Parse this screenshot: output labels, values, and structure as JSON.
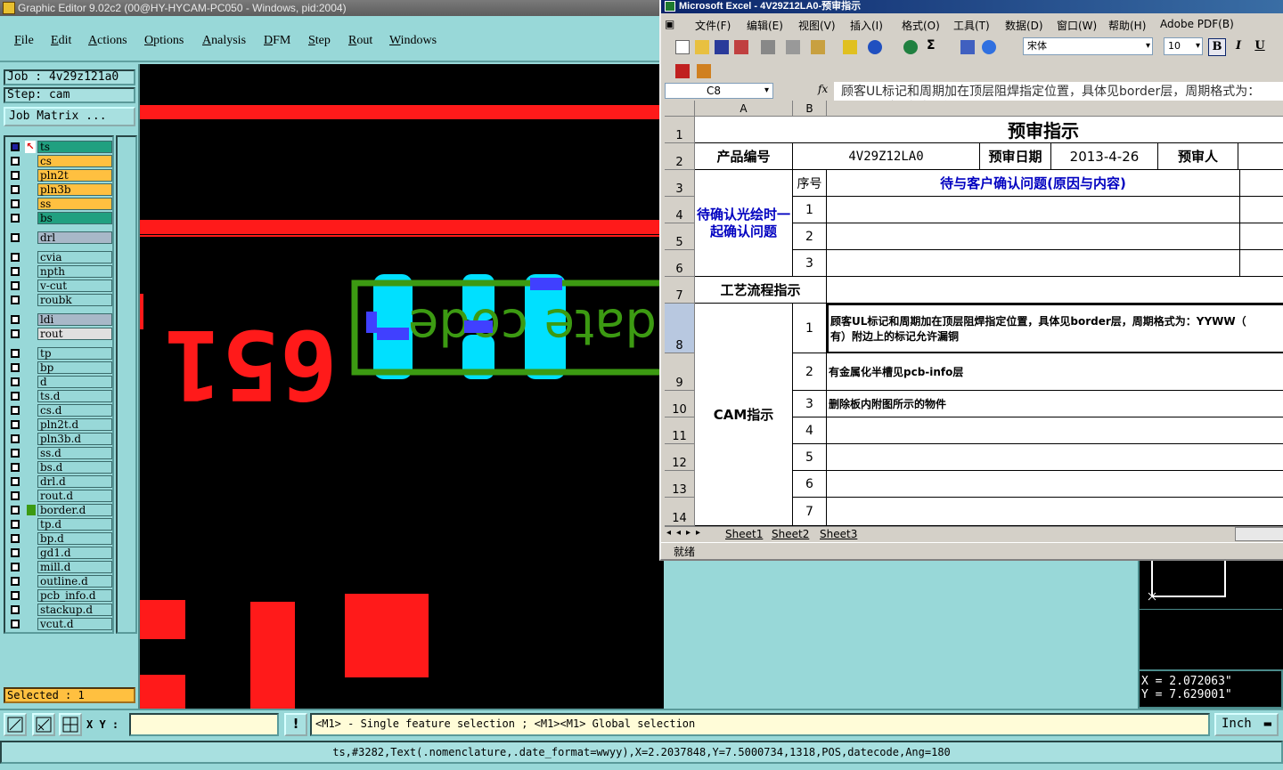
{
  "editor": {
    "title": "Graphic Editor 9.02c2 (00@HY-HYCAM-PC050 - Windows, pid:2004)",
    "menu": [
      "File",
      "Edit",
      "Actions",
      "Options",
      "Analysis",
      "DFM",
      "Step",
      "Rout",
      "Windows"
    ],
    "job": "Job : 4v29z121a0",
    "step": "Step: cam",
    "job_matrix_label": "Job Matrix ...",
    "layers": [
      {
        "name": "ts",
        "color": "#20a080"
      },
      {
        "name": "cs",
        "color": "#ffc040"
      },
      {
        "name": "pln2t",
        "color": "#ffc040"
      },
      {
        "name": "pln3b",
        "color": "#ffc040"
      },
      {
        "name": "ss",
        "color": "#ffc040"
      },
      {
        "name": "bs",
        "color": "#20a080"
      },
      {
        "name": "drl",
        "color": "#a8b8c8"
      },
      {
        "name": "cvia",
        "color": "#98d8d8"
      },
      {
        "name": "npth",
        "color": "#98d8d8"
      },
      {
        "name": "v-cut",
        "color": "#98d8d8"
      },
      {
        "name": "roubk",
        "color": "#98d8d8"
      },
      {
        "name": "ldi",
        "color": "#a8b8c8"
      },
      {
        "name": "rout",
        "color": "#e0e0e0"
      },
      {
        "name": "tp",
        "color": "#98d8d8"
      },
      {
        "name": "bp",
        "color": "#98d8d8"
      },
      {
        "name": "d",
        "color": "#98d8d8"
      },
      {
        "name": "ts.d",
        "color": "#98d8d8"
      },
      {
        "name": "cs.d",
        "color": "#98d8d8"
      },
      {
        "name": "pln2t.d",
        "color": "#98d8d8"
      },
      {
        "name": "pln3b.d",
        "color": "#98d8d8"
      },
      {
        "name": "ss.d",
        "color": "#98d8d8"
      },
      {
        "name": "bs.d",
        "color": "#98d8d8"
      },
      {
        "name": "drl.d",
        "color": "#98d8d8"
      },
      {
        "name": "rout.d",
        "color": "#98d8d8"
      },
      {
        "name": "border.d",
        "color": "#98d8d8"
      },
      {
        "name": "tp.d",
        "color": "#98d8d8"
      },
      {
        "name": "bp.d",
        "color": "#98d8d8"
      },
      {
        "name": "gd1.d",
        "color": "#98d8d8"
      },
      {
        "name": "mill.d",
        "color": "#98d8d8"
      },
      {
        "name": "outline.d",
        "color": "#98d8d8"
      },
      {
        "name": "pcb_info.d",
        "color": "#98d8d8"
      },
      {
        "name": "stackup.d",
        "color": "#98d8d8"
      },
      {
        "name": "vcut.d",
        "color": "#98d8d8"
      }
    ],
    "selected": "Selected : 1",
    "canvas_text": "651",
    "canvas_label_chars": [
      "e",
      "d",
      "o",
      "c",
      "e",
      "t",
      "a"
    ],
    "coords": {
      "x": "X = 2.072063\"",
      "y": "Y = 7.629001\""
    },
    "xy_label": "X Y :",
    "alert": "!",
    "prompt": "<M1> - Single feature selection ; <M1><M1> Global selection",
    "unit": "Inch",
    "status": "ts,#3282,Text(.nomenclature,.date_format=wwyy),X=2.2037848,Y=7.5000734,1318,POS,datecode,Ang=180",
    "colors": {
      "red": "#ff1a1a",
      "green": "#3c9a12",
      "cyan": "#00e0ff",
      "blue": "#4040ff"
    }
  },
  "excel": {
    "title": "Microsoft Excel - 4V29Z12LA0-预审指示",
    "menu": [
      "文件(F)",
      "编辑(E)",
      "视图(V)",
      "插入(I)",
      "格式(O)",
      "工具(T)",
      "数据(D)",
      "窗口(W)",
      "帮助(H)",
      "Adobe PDF(B)"
    ],
    "font_name": "宋体",
    "font_size": "10",
    "bold": "B",
    "italic": "I",
    "underline": "U",
    "name_box": "C8",
    "fx": "fx",
    "formula": "顾客UL标记和周期加在顶层阻焊指定位置，具体见border层，周期格式为：YYWW（记允许漏铜",
    "columns": [
      "A",
      "B"
    ],
    "rows": [
      "1",
      "2",
      "3",
      "4",
      "5",
      "6",
      "7",
      "8",
      "9",
      "10",
      "11",
      "12",
      "13",
      "14"
    ],
    "cells": {
      "title": "预审指示",
      "product_no_label": "产品编号",
      "product_no": "4V29Z12LA0",
      "review_date_label": "预审日期",
      "review_date": "2013-4-26",
      "reviewer_label": "预审人",
      "confirm_group": "待确认光绘时一起确认问题",
      "seq_label": "序号",
      "issues_header": "待与客户确认问题(原因与内容)",
      "process_label": "工艺流程指示",
      "cam_label": "CAM指示",
      "nums": [
        "1",
        "2",
        "3",
        "1",
        "2",
        "3",
        "4",
        "5",
        "6",
        "7"
      ],
      "cam_1": "顾客UL标记和周期加在顶层阻焊指定位置，具体见border层，周期格式为：YYWW（",
      "cam_1b": "有）附边上的标记允许漏铜",
      "cam_2": "有金属化半槽见pcb-info层",
      "cam_3": "删除板内附图所示的物件"
    },
    "sheets": [
      "Sheet1",
      "Sheet2",
      "Sheet3"
    ],
    "status": "就绪"
  }
}
